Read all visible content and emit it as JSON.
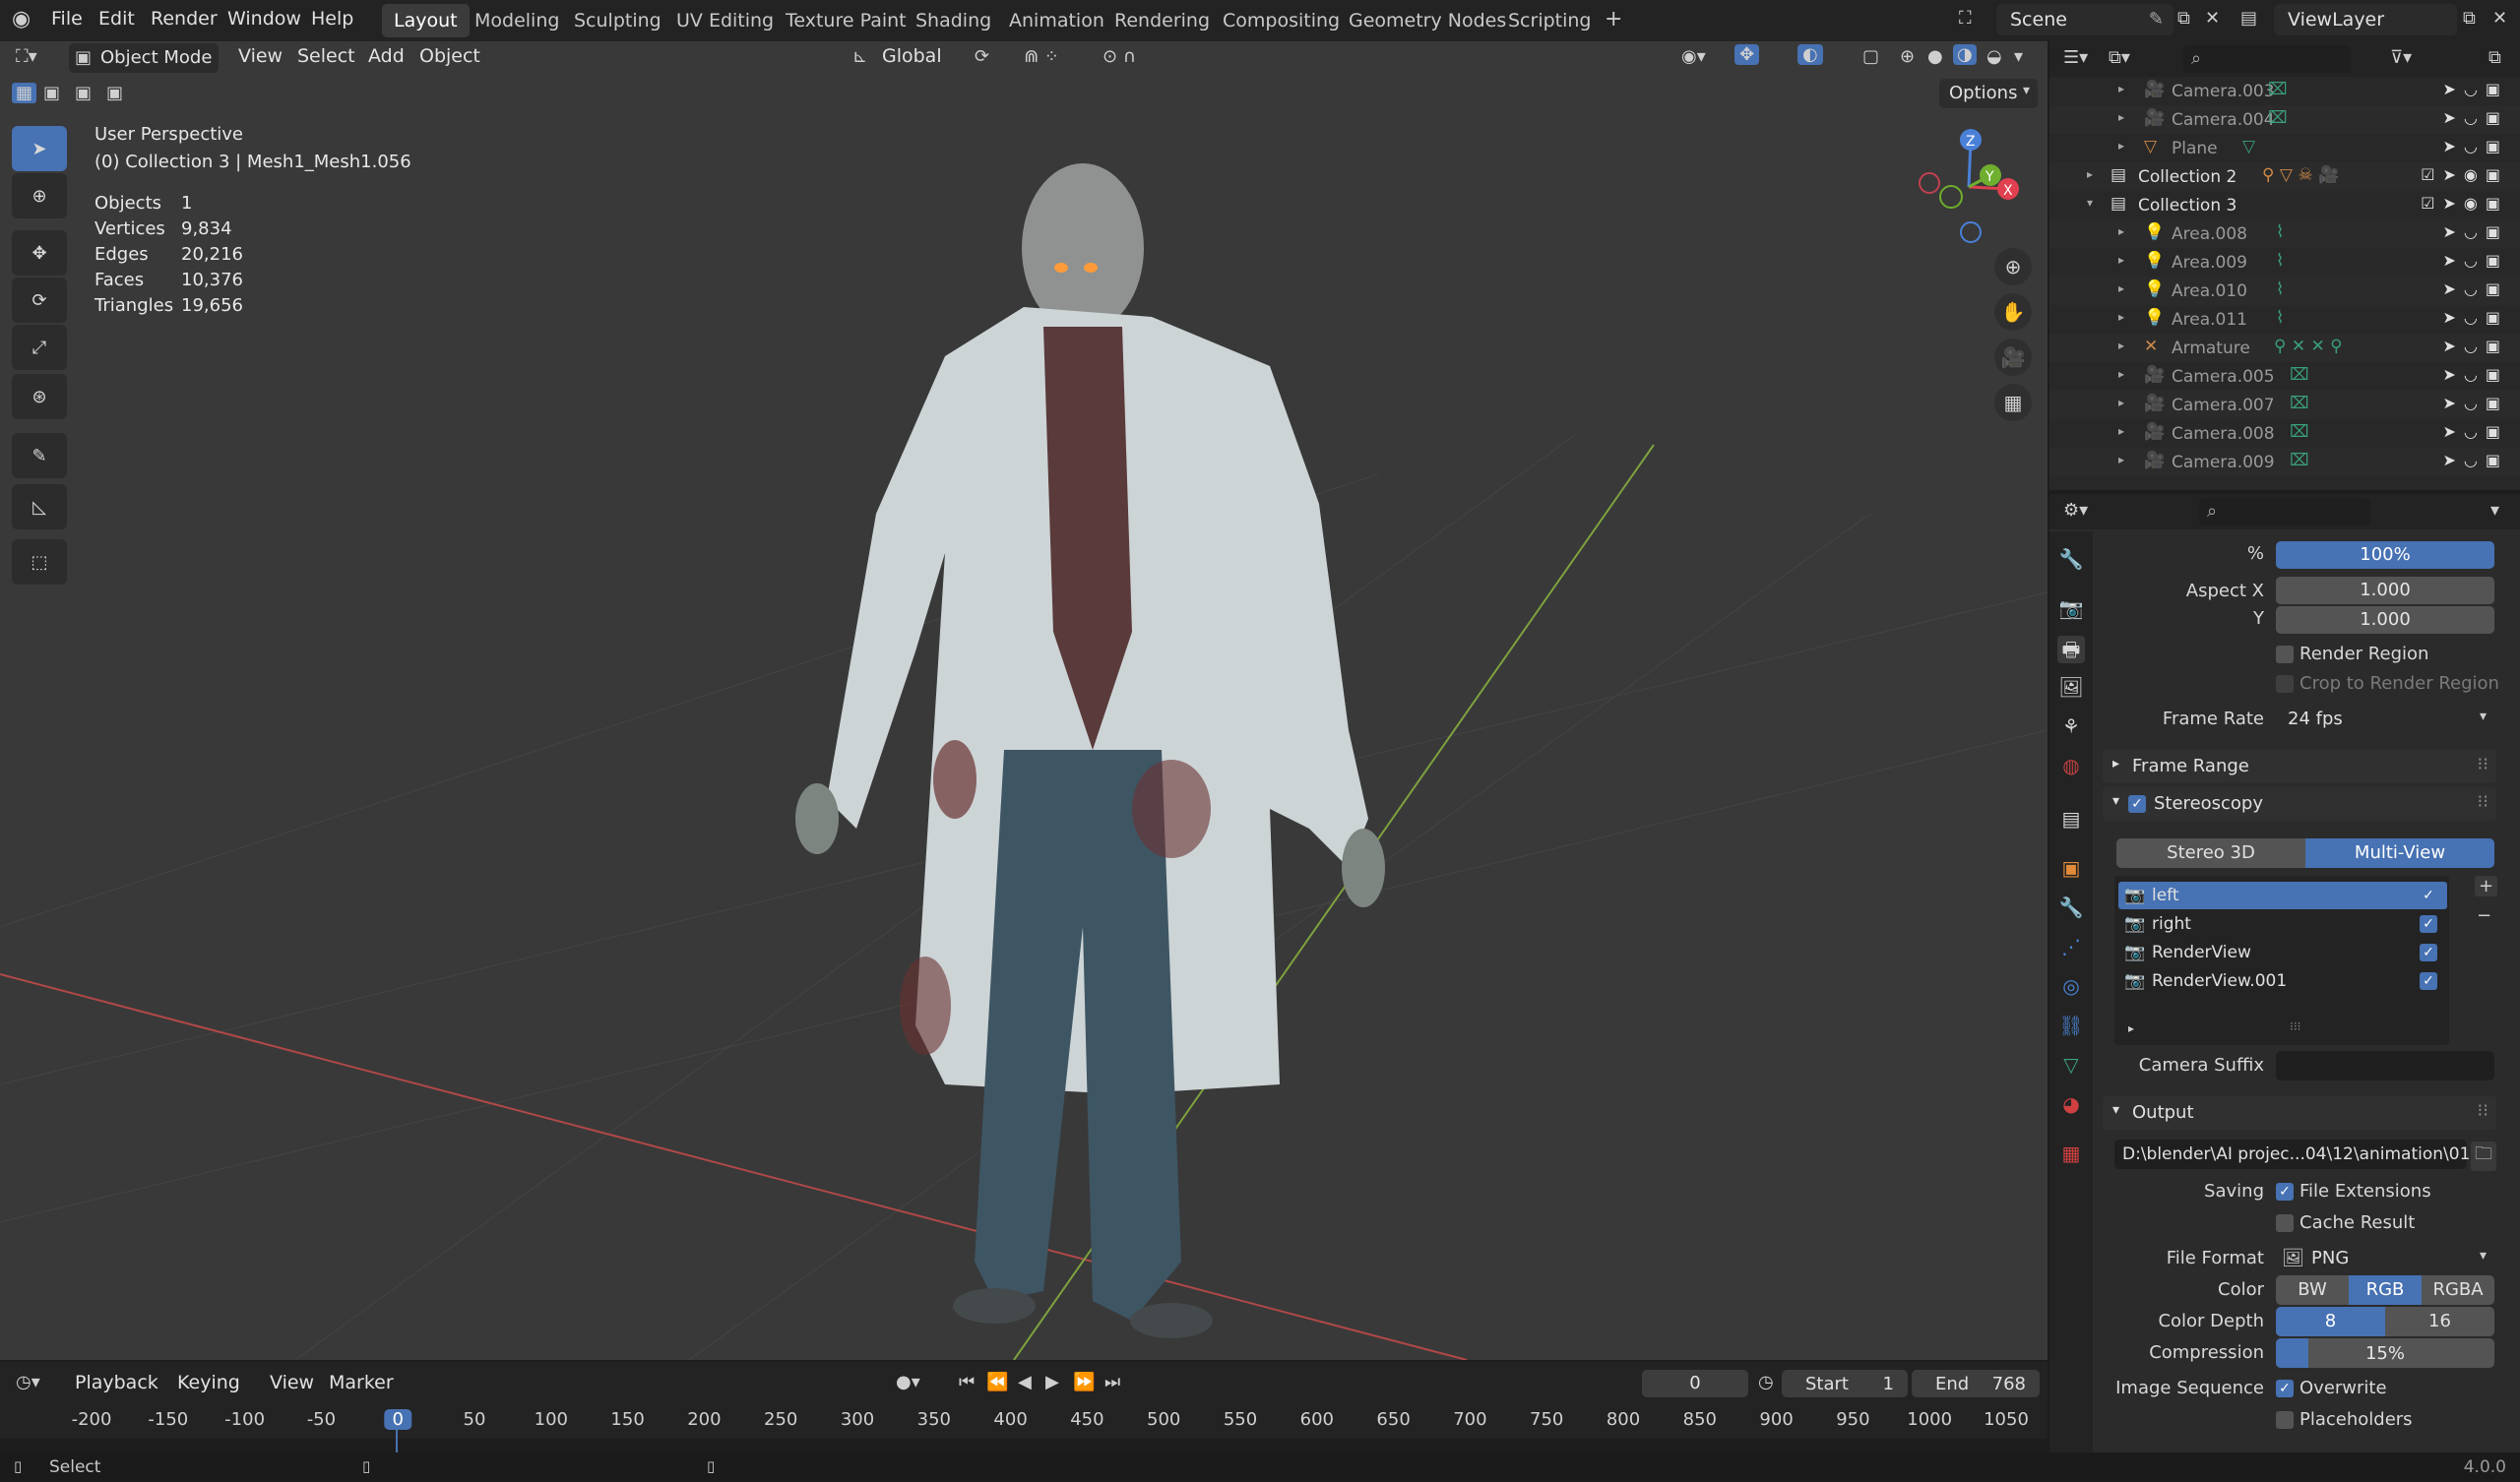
{
  "topbar": {
    "menus": [
      "File",
      "Edit",
      "Render",
      "Window",
      "Help"
    ],
    "workspaces": [
      "Layout",
      "Modeling",
      "Sculpting",
      "UV Editing",
      "Texture Paint",
      "Shading",
      "Animation",
      "Rendering",
      "Compositing",
      "Geometry Nodes",
      "Scripting"
    ],
    "active_workspace": "Layout",
    "add_tab": "+",
    "scene": "Scene",
    "view_layer": "ViewLayer"
  },
  "viewport_header": {
    "mode": "Object Mode",
    "menus": [
      "View",
      "Select",
      "Add",
      "Object"
    ],
    "orientation": "Global",
    "options": "Options"
  },
  "overlay": {
    "view_name": "User Perspective",
    "collection_info": "(0) Collection 3 | Mesh1_Mesh1.056",
    "stats": [
      {
        "label": "Objects",
        "value": "1"
      },
      {
        "label": "Vertices",
        "value": "9,834"
      },
      {
        "label": "Edges",
        "value": "20,216"
      },
      {
        "label": "Faces",
        "value": "10,376"
      },
      {
        "label": "Triangles",
        "value": "19,656"
      }
    ]
  },
  "gizmo": {
    "x": "X",
    "y": "Y",
    "z": "Z"
  },
  "outliner": {
    "rows": [
      {
        "name": "Camera.003",
        "kind": "camera",
        "indent": 2
      },
      {
        "name": "Camera.004",
        "kind": "camera",
        "indent": 2
      },
      {
        "name": "Plane",
        "kind": "mesh",
        "indent": 2
      },
      {
        "name": "Collection 2",
        "kind": "collection",
        "indent": 1
      },
      {
        "name": "Collection 3",
        "kind": "collection",
        "indent": 1
      },
      {
        "name": "Area.008",
        "kind": "light",
        "indent": 2
      },
      {
        "name": "Area.009",
        "kind": "light",
        "indent": 2
      },
      {
        "name": "Area.010",
        "kind": "light",
        "indent": 2
      },
      {
        "name": "Area.011",
        "kind": "light",
        "indent": 2
      },
      {
        "name": "Armature",
        "kind": "armature",
        "indent": 2
      },
      {
        "name": "Camera.005",
        "kind": "camera",
        "indent": 2
      },
      {
        "name": "Camera.007",
        "kind": "camera",
        "indent": 2
      },
      {
        "name": "Camera.008",
        "kind": "camera",
        "indent": 2
      },
      {
        "name": "Camera.009",
        "kind": "camera",
        "indent": 2
      }
    ]
  },
  "properties": {
    "resolution_pct": "100%",
    "pct_label": "%",
    "aspect_x_label": "Aspect X",
    "aspect_x": "1.000",
    "aspect_y_label": "Y",
    "aspect_y": "1.000",
    "render_region": "Render Region",
    "crop_region": "Crop to Render Region",
    "frame_rate_label": "Frame Rate",
    "frame_rate": "24 fps",
    "frame_range_panel": "Frame Range",
    "stereoscopy_panel": "Stereoscopy",
    "stereo_modes": [
      "Stereo 3D",
      "Multi-View"
    ],
    "active_stereo_mode": "Multi-View",
    "views": [
      "left",
      "right",
      "RenderView",
      "RenderView.001"
    ],
    "camera_suffix_label": "Camera Suffix",
    "output_panel": "Output",
    "output_path": "D:\\blender\\AI projec...04\\12\\animation\\01",
    "saving_label": "Saving",
    "file_extensions": "File Extensions",
    "cache_result": "Cache Result",
    "file_format_label": "File Format",
    "file_format": "PNG",
    "color_label": "Color",
    "color_modes": [
      "BW",
      "RGB",
      "RGBA"
    ],
    "active_color": "RGB",
    "color_depth_label": "Color Depth",
    "color_depths": [
      "8",
      "16"
    ],
    "active_depth": "8",
    "compression_label": "Compression",
    "compression": "15%",
    "compression_fraction": 0.15,
    "image_sequence_label": "Image Sequence",
    "overwrite": "Overwrite",
    "placeholders": "Placeholders"
  },
  "timeline": {
    "menus": [
      "Playback",
      "Keying",
      "View",
      "Marker"
    ],
    "current_frame": "0",
    "start_label": "Start",
    "start": "1",
    "end_label": "End",
    "end": "768",
    "ticks": [
      "-200",
      "-150",
      "-100",
      "-50",
      "0",
      "50",
      "100",
      "150",
      "200",
      "250",
      "300",
      "350",
      "400",
      "450",
      "500",
      "550",
      "600",
      "650",
      "700",
      "750",
      "800",
      "850",
      "900",
      "950",
      "1000",
      "1050"
    ]
  },
  "statusbar": {
    "select": "Select",
    "version": "4.0.0"
  },
  "colors": {
    "accent": "#4772b3",
    "viewport_bg": "#393939",
    "panel_bg": "#2b2b2b"
  }
}
